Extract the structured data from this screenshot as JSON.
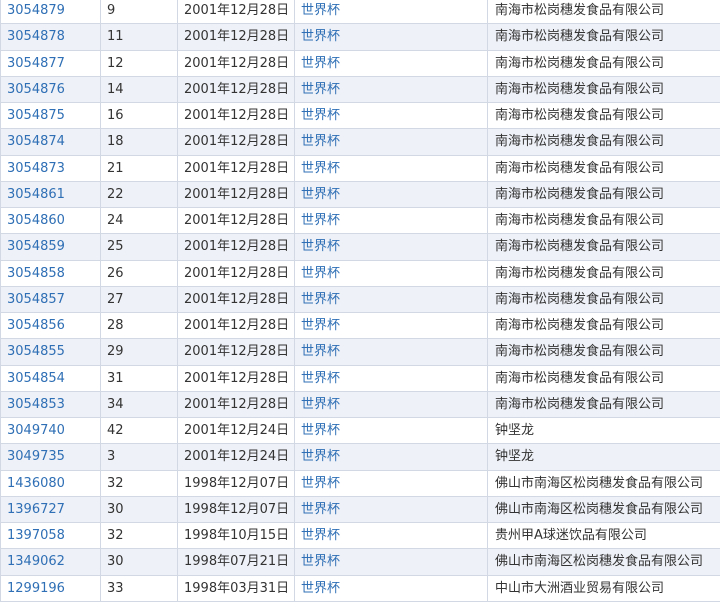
{
  "table": {
    "rows": [
      {
        "reg": "3054879",
        "cls": "9",
        "date": "2001年12月28日",
        "mark": "世界杯",
        "owner": "南海市松岗穗发食品有限公司"
      },
      {
        "reg": "3054878",
        "cls": "11",
        "date": "2001年12月28日",
        "mark": "世界杯",
        "owner": "南海市松岗穗发食品有限公司"
      },
      {
        "reg": "3054877",
        "cls": "12",
        "date": "2001年12月28日",
        "mark": "世界杯",
        "owner": "南海市松岗穗发食品有限公司"
      },
      {
        "reg": "3054876",
        "cls": "14",
        "date": "2001年12月28日",
        "mark": "世界杯",
        "owner": "南海市松岗穗发食品有限公司"
      },
      {
        "reg": "3054875",
        "cls": "16",
        "date": "2001年12月28日",
        "mark": "世界杯",
        "owner": "南海市松岗穗发食品有限公司"
      },
      {
        "reg": "3054874",
        "cls": "18",
        "date": "2001年12月28日",
        "mark": "世界杯",
        "owner": "南海市松岗穗发食品有限公司"
      },
      {
        "reg": "3054873",
        "cls": "21",
        "date": "2001年12月28日",
        "mark": "世界杯",
        "owner": "南海市松岗穗发食品有限公司"
      },
      {
        "reg": "3054861",
        "cls": "22",
        "date": "2001年12月28日",
        "mark": "世界杯",
        "owner": "南海市松岗穗发食品有限公司"
      },
      {
        "reg": "3054860",
        "cls": "24",
        "date": "2001年12月28日",
        "mark": "世界杯",
        "owner": "南海市松岗穗发食品有限公司"
      },
      {
        "reg": "3054859",
        "cls": "25",
        "date": "2001年12月28日",
        "mark": "世界杯",
        "owner": "南海市松岗穗发食品有限公司"
      },
      {
        "reg": "3054858",
        "cls": "26",
        "date": "2001年12月28日",
        "mark": "世界杯",
        "owner": "南海市松岗穗发食品有限公司"
      },
      {
        "reg": "3054857",
        "cls": "27",
        "date": "2001年12月28日",
        "mark": "世界杯",
        "owner": "南海市松岗穗发食品有限公司"
      },
      {
        "reg": "3054856",
        "cls": "28",
        "date": "2001年12月28日",
        "mark": "世界杯",
        "owner": "南海市松岗穗发食品有限公司"
      },
      {
        "reg": "3054855",
        "cls": "29",
        "date": "2001年12月28日",
        "mark": "世界杯",
        "owner": "南海市松岗穗发食品有限公司"
      },
      {
        "reg": "3054854",
        "cls": "31",
        "date": "2001年12月28日",
        "mark": "世界杯",
        "owner": "南海市松岗穗发食品有限公司"
      },
      {
        "reg": "3054853",
        "cls": "34",
        "date": "2001年12月28日",
        "mark": "世界杯",
        "owner": "南海市松岗穗发食品有限公司"
      },
      {
        "reg": "3049740",
        "cls": "42",
        "date": "2001年12月24日",
        "mark": "世界杯",
        "owner": "钟坚龙"
      },
      {
        "reg": "3049735",
        "cls": "3",
        "date": "2001年12月24日",
        "mark": "世界杯",
        "owner": "钟坚龙"
      },
      {
        "reg": "1436080",
        "cls": "32",
        "date": "1998年12月07日",
        "mark": "世界杯",
        "owner": "佛山市南海区松岗穗发食品有限公司"
      },
      {
        "reg": "1396727",
        "cls": "30",
        "date": "1998年12月07日",
        "mark": "世界杯",
        "owner": "佛山市南海区松岗穗发食品有限公司"
      },
      {
        "reg": "1397058",
        "cls": "32",
        "date": "1998年10月15日",
        "mark": "世界杯",
        "owner": "贵州甲A球迷饮品有限公司"
      },
      {
        "reg": "1349062",
        "cls": "30",
        "date": "1998年07月21日",
        "mark": "世界杯",
        "owner": "佛山市南海区松岗穗发食品有限公司"
      },
      {
        "reg": "1299196",
        "cls": "33",
        "date": "1998年03月31日",
        "mark": "世界杯",
        "owner": "中山市大洲酒业贸易有限公司"
      }
    ]
  }
}
